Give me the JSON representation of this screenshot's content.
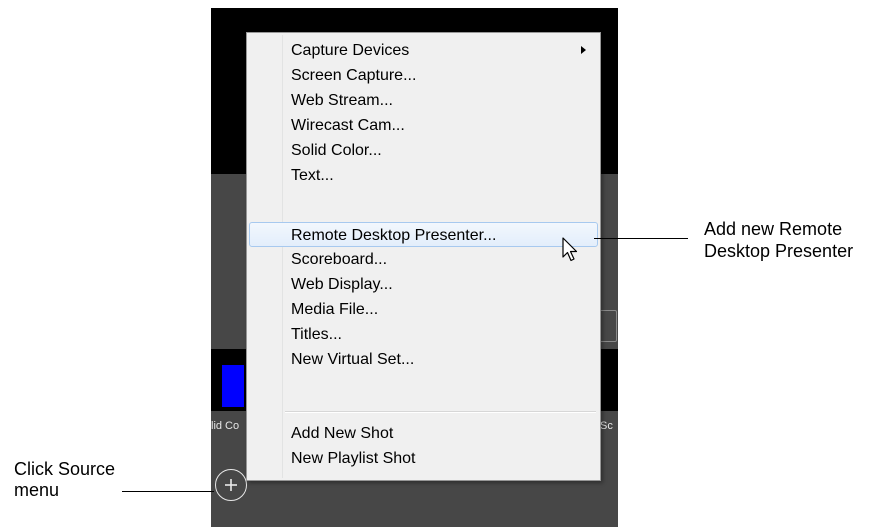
{
  "menu": {
    "items": [
      {
        "label": "Capture Devices",
        "submenu": true
      },
      {
        "label": "Screen Capture..."
      },
      {
        "label": "Web Stream..."
      },
      {
        "label": "Wirecast Cam..."
      },
      {
        "label": "Solid Color..."
      },
      {
        "label": "Text..."
      },
      {
        "label": "Remote Desktop Presenter...",
        "highlighted": true
      },
      {
        "label": "Scoreboard..."
      },
      {
        "label": "Web Display..."
      },
      {
        "label": "Media File..."
      },
      {
        "label": "Titles..."
      },
      {
        "label": "New Virtual Set..."
      }
    ],
    "extra_items": [
      {
        "label": "Add New Shot"
      },
      {
        "label": "New Playlist Shot"
      }
    ]
  },
  "shots": {
    "left_label": "lid Co",
    "right_label": "Sc",
    "left_color": "#0000ff"
  },
  "callouts": {
    "remote_desktop": {
      "line1": "Add new Remote",
      "line2": "Desktop Presenter"
    },
    "source_menu": {
      "line1": "Click Source",
      "line2": "menu"
    }
  },
  "icons": {
    "add_source": "plus-circle-icon",
    "cursor": "mouse-pointer-icon",
    "submenu": "chevron-right-icon"
  },
  "colors": {
    "menu_hover_border": "#a7c9ef",
    "panel_bg": "#474747"
  }
}
